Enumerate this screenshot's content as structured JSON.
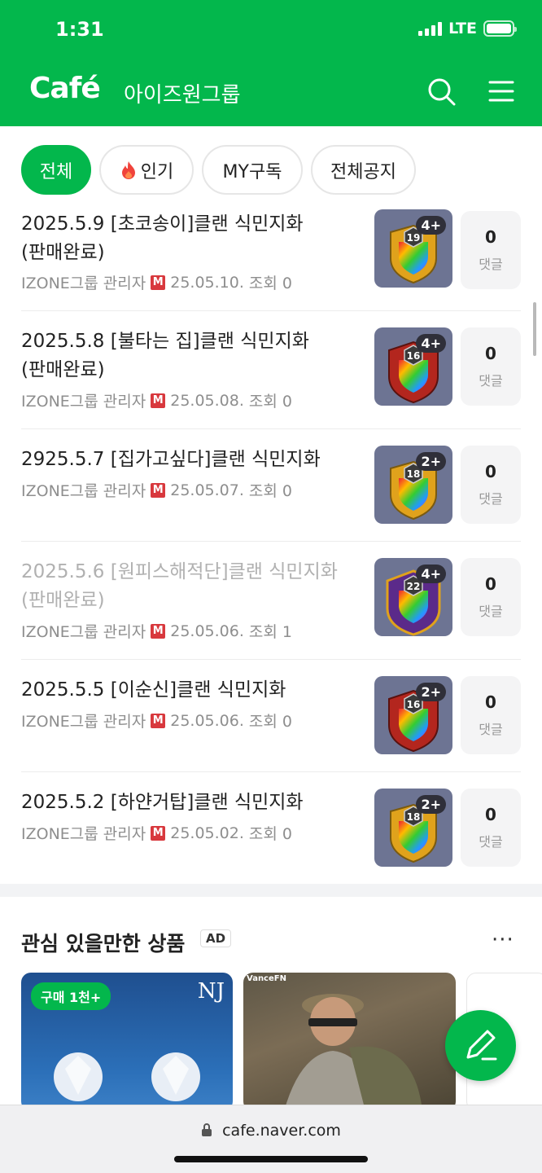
{
  "status_bar": {
    "time": "1:31",
    "network": "LTE"
  },
  "header": {
    "logo": "Café",
    "cafe_name": "아이즈원그룹"
  },
  "filters": [
    {
      "label": "전체",
      "active": true
    },
    {
      "label": "인기",
      "icon": "fire-icon"
    },
    {
      "label": "MY구독"
    },
    {
      "label": "전체공지"
    }
  ],
  "posts": [
    {
      "title": "2025.5.9 [초코송이]클랜 식민지화 (판매완료)",
      "author": "IZONE그룹 관리자",
      "manager_badge": "M",
      "date": "25.05.10.",
      "views": "조회 0",
      "level": "4+",
      "clan_level": "19",
      "comments": "0",
      "comments_label": "댓글"
    },
    {
      "title": "2025.5.8 [불타는 집]클랜 식민지화 (판매완료)",
      "author": "IZONE그룹 관리자",
      "manager_badge": "M",
      "date": "25.05.08.",
      "views": "조회 0",
      "level": "4+",
      "clan_level": "16",
      "comments": "0",
      "comments_label": "댓글"
    },
    {
      "title": "2925.5.7 [집가고싶다]클랜 식민지화",
      "author": "IZONE그룹 관리자",
      "manager_badge": "M",
      "date": "25.05.07.",
      "views": "조회 0",
      "level": "2+",
      "clan_level": "18",
      "comments": "0",
      "comments_label": "댓글"
    },
    {
      "title": "2025.5.6 [원피스해적단]클랜 식민지화 (판매완료)",
      "author": "IZONE그룹 관리자",
      "manager_badge": "M",
      "date": "25.05.06.",
      "views": "조회 1",
      "level": "4+",
      "clan_level": "22",
      "comments": "0",
      "comments_label": "댓글"
    },
    {
      "title": "2025.5.5 [이순신]클랜 식민지화",
      "author": "IZONE그룹 관리자",
      "manager_badge": "M",
      "date": "25.05.06.",
      "views": "조회 0",
      "level": "2+",
      "clan_level": "16",
      "comments": "0",
      "comments_label": "댓글"
    },
    {
      "title": "2025.5.2 [하얀거탑]클랜 식민지화",
      "author": "IZONE그룹 관리자",
      "manager_badge": "M",
      "date": "25.05.02.",
      "views": "조회 0",
      "level": "2+",
      "clan_level": "18",
      "comments": "0",
      "comments_label": "댓글"
    }
  ],
  "ads": {
    "heading": "관심 있을만한 상품",
    "ad_label": "AD",
    "more": "···",
    "cards": [
      {
        "badge": "구매 1천+",
        "brand": "NJ"
      },
      {
        "brand": "VanceFN"
      }
    ]
  },
  "url_bar": {
    "url": "cafe.naver.com"
  },
  "colors": {
    "brand_green": "#03b74c",
    "manager_red": "#d8383d"
  }
}
